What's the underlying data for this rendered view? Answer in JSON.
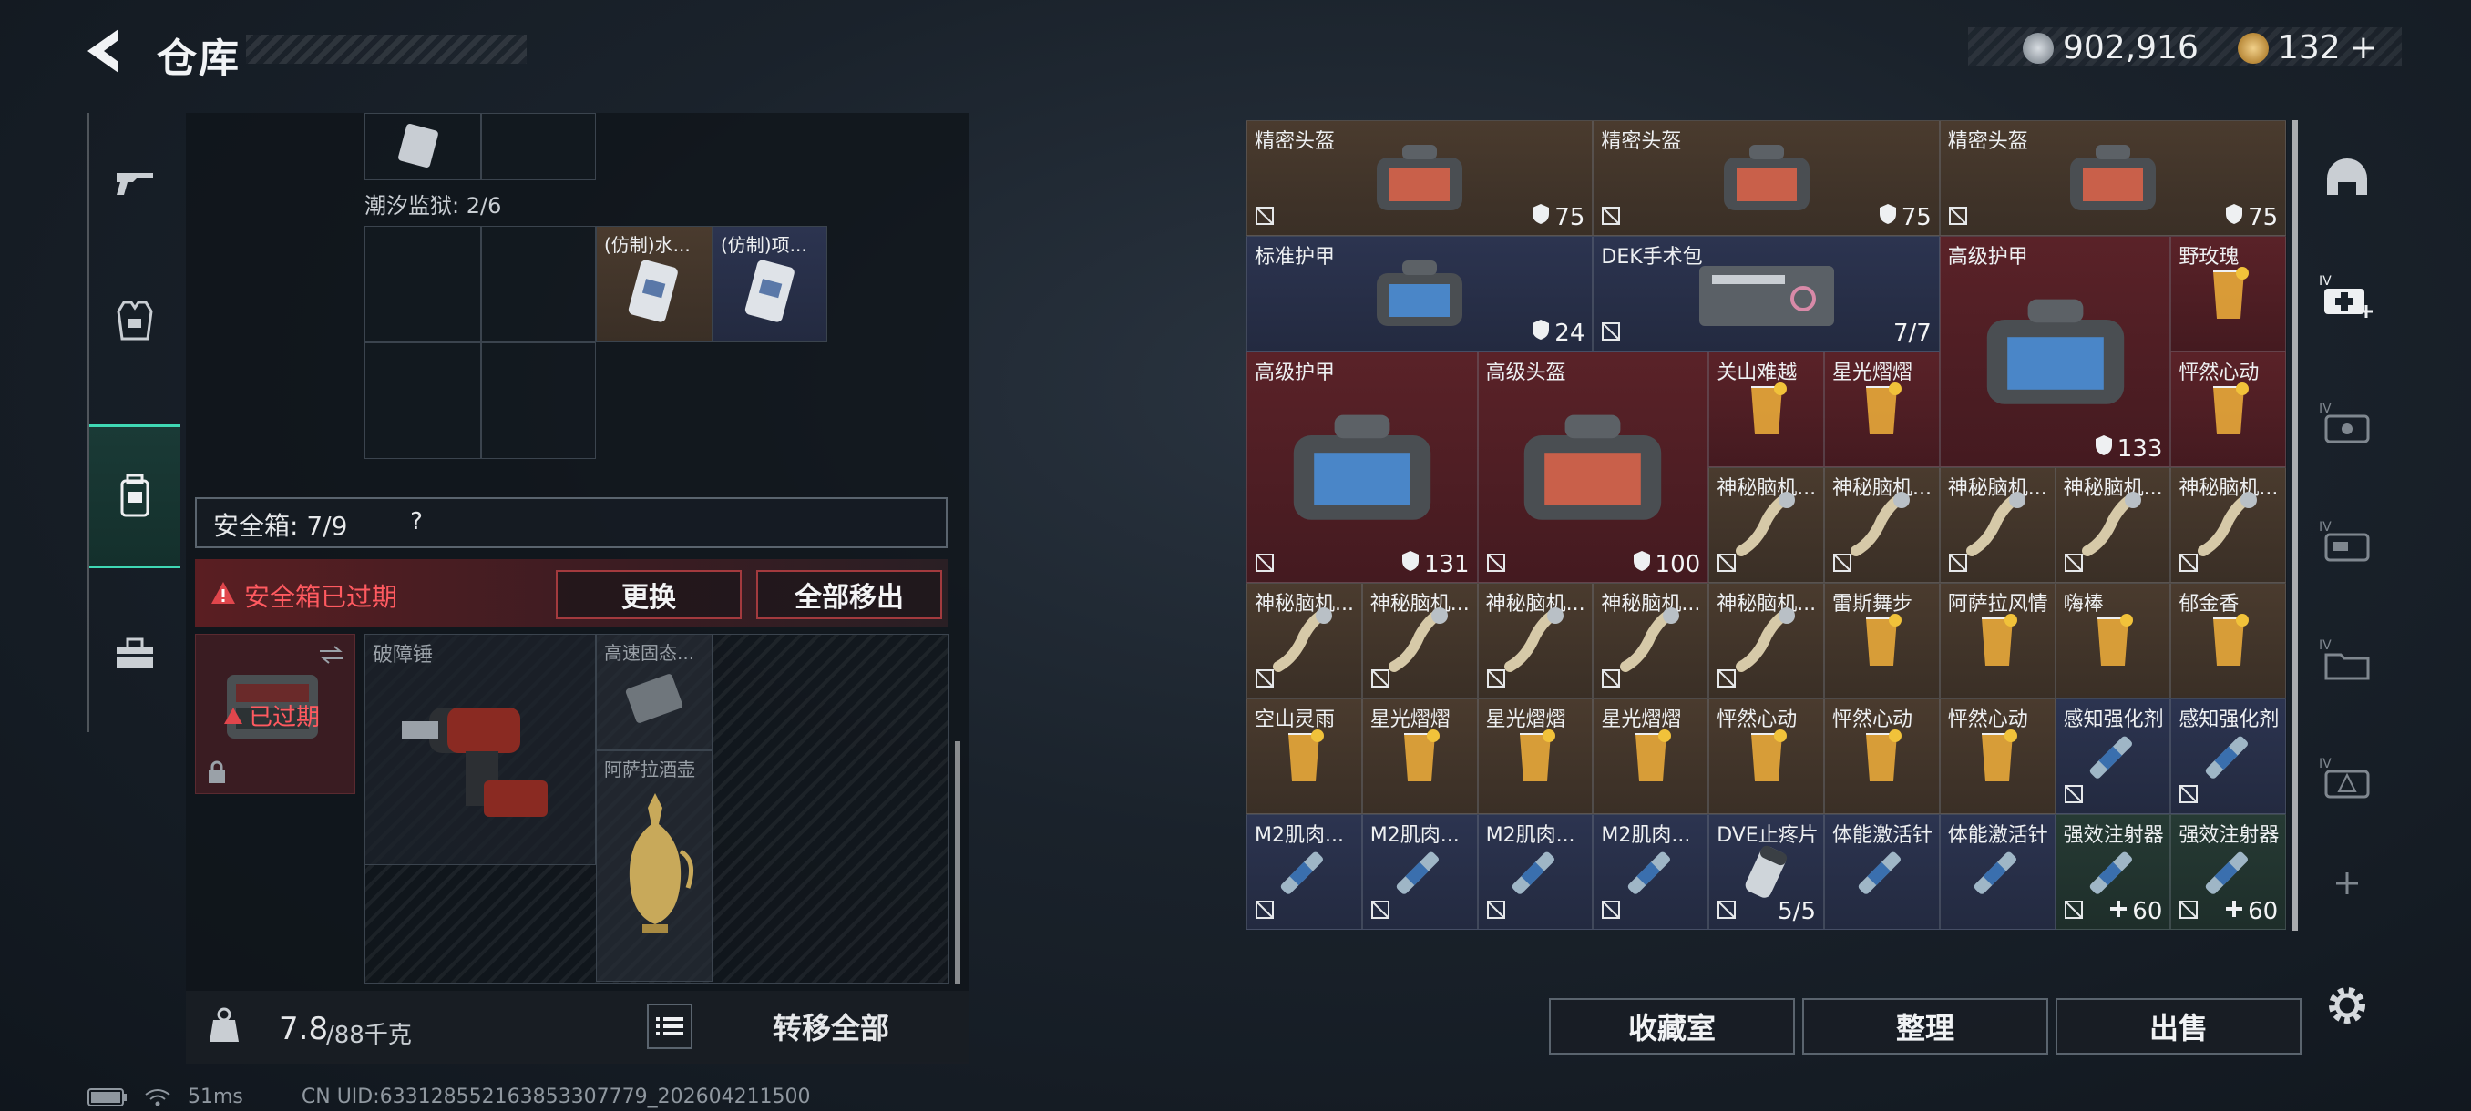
{
  "header": {
    "title": "仓库",
    "silver_amount": "902,916",
    "gold_amount": "132",
    "plus_label": "+"
  },
  "left_panel": {
    "section_label": "潮汐监狱: 2/6",
    "small_items": [
      "(仿制)水...",
      "(仿制)项..."
    ],
    "safe_box_label": "安全箱: 7/9",
    "help_label": "?",
    "warning_text": "安全箱已过期",
    "replace_button": "更换",
    "move_all_out_button": "全部移出",
    "expired_label": "已过期",
    "safebox_items": [
      "破障锤",
      "高速固态...",
      "阿萨拉酒壶"
    ],
    "weight_value": "7.8",
    "weight_capacity": "/88千克",
    "transfer_all_button": "转移全部"
  },
  "grid_items": [
    {
      "name": "精密头盔",
      "badge": "75"
    },
    {
      "name": "精密头盔",
      "badge": "75"
    },
    {
      "name": "精密头盔",
      "badge": "75"
    },
    {
      "name": "标准护甲",
      "badge": "24"
    },
    {
      "name": "DEK手术包",
      "badge": "7/7"
    },
    {
      "name": "高级护甲",
      "badge": "133"
    },
    {
      "name": "野玫瑰",
      "badge": ""
    },
    {
      "name": "高级护甲",
      "badge": "131"
    },
    {
      "name": "高级头盔",
      "badge": "100"
    },
    {
      "name": "关山难越",
      "badge": ""
    },
    {
      "name": "星光熠熠",
      "badge": ""
    },
    {
      "name": "怦然心动",
      "badge": ""
    },
    {
      "name": "神秘脑机...",
      "badge": ""
    },
    {
      "name": "神秘脑机...",
      "badge": ""
    },
    {
      "name": "神秘脑机...",
      "badge": ""
    },
    {
      "name": "神秘脑机...",
      "badge": ""
    },
    {
      "name": "神秘脑机...",
      "badge": ""
    },
    {
      "name": "神秘脑机...",
      "badge": ""
    },
    {
      "name": "神秘脑机...",
      "badge": ""
    },
    {
      "name": "神秘脑机...",
      "badge": ""
    },
    {
      "name": "神秘脑机...",
      "badge": ""
    },
    {
      "name": "神秘脑机...",
      "badge": ""
    },
    {
      "name": "雷斯舞步",
      "badge": ""
    },
    {
      "name": "阿萨拉风情",
      "badge": ""
    },
    {
      "name": "嗨棒",
      "badge": ""
    },
    {
      "name": "郁金香",
      "badge": ""
    },
    {
      "name": "空山灵雨",
      "badge": ""
    },
    {
      "name": "星光熠熠",
      "badge": ""
    },
    {
      "name": "星光熠熠",
      "badge": ""
    },
    {
      "name": "星光熠熠",
      "badge": ""
    },
    {
      "name": "怦然心动",
      "badge": ""
    },
    {
      "name": "怦然心动",
      "badge": ""
    },
    {
      "name": "怦然心动",
      "badge": ""
    },
    {
      "name": "感知强化剂",
      "badge": ""
    },
    {
      "name": "感知强化剂",
      "badge": ""
    },
    {
      "name": "M2肌肉...",
      "badge": ""
    },
    {
      "name": "M2肌肉...",
      "badge": ""
    },
    {
      "name": "M2肌肉...",
      "badge": ""
    },
    {
      "name": "M2肌肉...",
      "badge": ""
    },
    {
      "name": "DVE止疼片",
      "badge": "5/5"
    },
    {
      "name": "体能激活针",
      "badge": ""
    },
    {
      "name": "体能激活针",
      "badge": ""
    },
    {
      "name": "强效注射器",
      "badge": "60"
    },
    {
      "name": "强效注射器",
      "badge": "60"
    }
  ],
  "bottom_buttons": {
    "collection": "收藏室",
    "organize": "整理",
    "sell": "出售"
  },
  "status_bar": {
    "ping": "51ms",
    "uid": "CN UID:633128552163853307779_202604211500"
  },
  "colors": {
    "accent_teal": "#3fd8b4",
    "warning_red": "#e0464c",
    "rarity_brown": "#4a3b2e",
    "rarity_red": "#5a2228",
    "rarity_blue": "#2c3450",
    "rarity_green": "#263a34"
  }
}
